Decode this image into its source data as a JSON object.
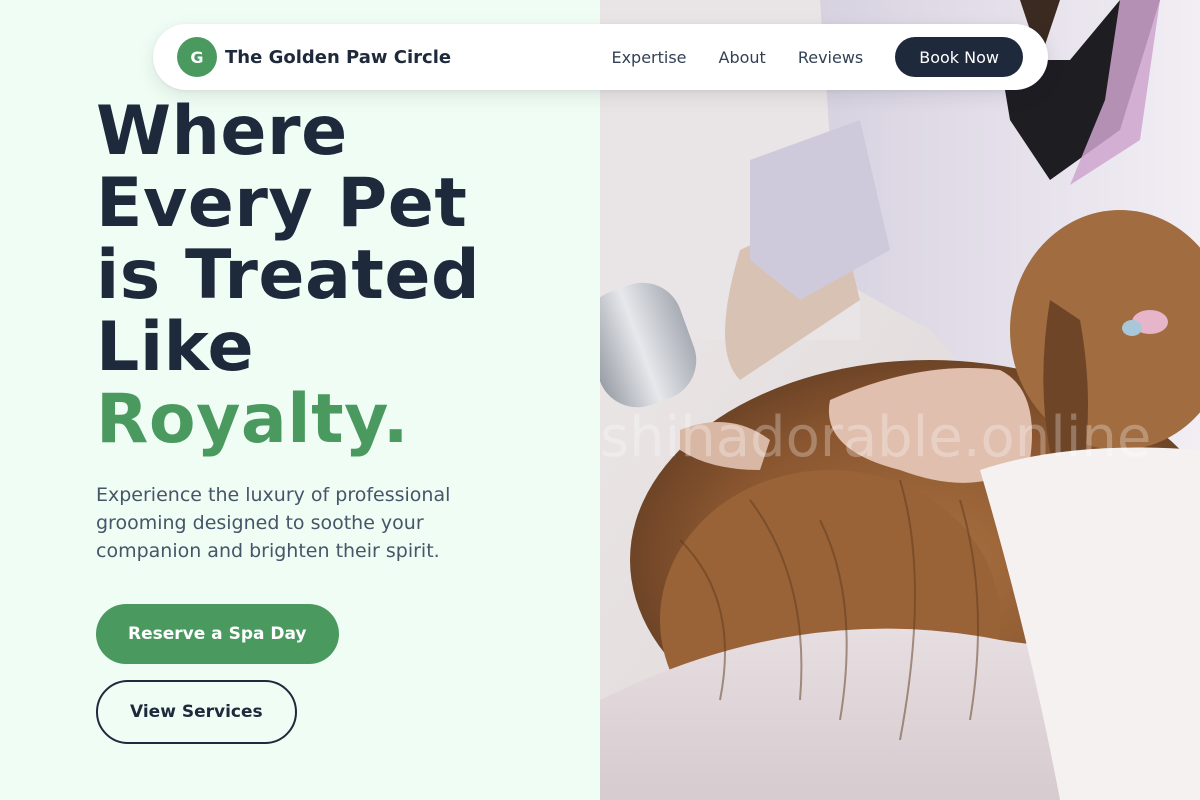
{
  "brand": {
    "initial": "G",
    "name": "The Golden Paw Circle"
  },
  "nav": {
    "links": [
      "Expertise",
      "About",
      "Reviews"
    ],
    "cta": "Book Now"
  },
  "hero": {
    "title_lines": [
      "Where",
      "Every Pet",
      "is Treated",
      "Like"
    ],
    "title_accent": "Royalty.",
    "subtitle": "Experience the luxury of professional grooming designed to soothe your companion and brighten their spirit.",
    "primary_cta": "Reserve a Spa Day",
    "secondary_cta": "View Services"
  },
  "image": {
    "watermark": "shihadorable.online",
    "icon": "groomer-drying-dog-photo"
  },
  "colors": {
    "accent_green": "#4a9a60",
    "dark_navy": "#1e293b",
    "background_mint": "#effdf4"
  }
}
